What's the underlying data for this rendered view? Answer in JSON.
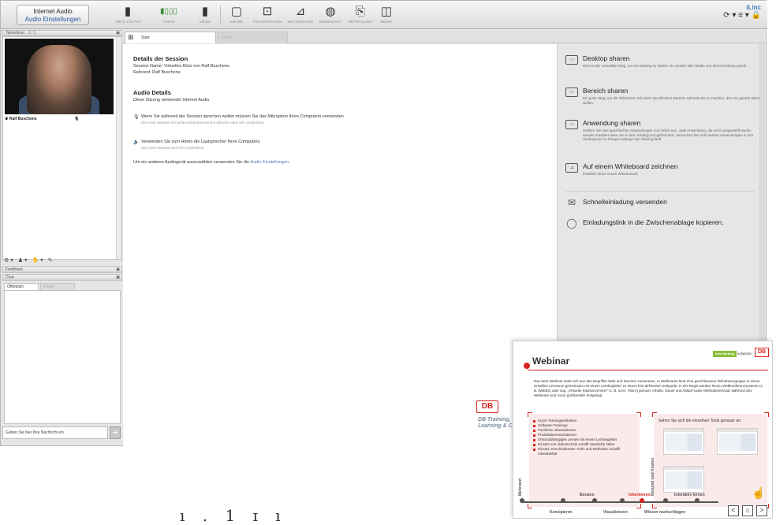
{
  "toolbar": {
    "audio_button": {
      "title": "Internet Audio",
      "subtitle": "Audio Einstellungen"
    },
    "items": [
      {
        "icon": "status-icon",
        "glyph": "▮",
        "label": "MEIN STATUS"
      },
      {
        "icon": "audio-level-icon",
        "glyph": "▮▯▯▯",
        "label": "AUDIO"
      },
      {
        "icon": "video-icon",
        "glyph": "▮",
        "label": "VIDEO"
      },
      {
        "icon": "share-icon",
        "glyph": "▢",
        "label": "SHARE"
      },
      {
        "icon": "presentation-icon",
        "glyph": "⊡",
        "label": "PRÄSENTATION"
      },
      {
        "icon": "whiteboard-icon",
        "glyph": "⊿",
        "label": "WHITEBOARD"
      },
      {
        "icon": "web-content-icon",
        "glyph": "◍",
        "label": "WEBINHALT"
      },
      {
        "icon": "poll-icon",
        "glyph": "⎘",
        "label": "BEFRAGUNG"
      },
      {
        "icon": "media-icon",
        "glyph": "◫",
        "label": "MEDIA"
      }
    ],
    "brand": {
      "name": "iLinc",
      "controls": "⟳ ▾ ≡ ▾ 🔒"
    }
  },
  "participants": {
    "header": "Teilnehmer",
    "count": "1 / 1",
    "participant_name": "Ralf Buschens",
    "controls": "⚙▾ ♟▾ ✋▾ ✎"
  },
  "feedback": {
    "header": "Feedback"
  },
  "chat": {
    "header": "Chat",
    "tabs": [
      "Öffentlich",
      "Privat"
    ],
    "input_placeholder": "Geben Sie hier Ihre Nachricht ein",
    "send_glyph": "➔"
  },
  "tabs": {
    "start": "Start",
    "ghost": "Privat"
  },
  "session": {
    "details_heading": "Details der Session",
    "session_name": "Session Name: Virtuelles Büro von Ralf Buschens",
    "referent": "Referent: Ralf Buschens",
    "audio_heading": "Audio Details",
    "audio_desc": "Diese Sitzung verwendet Internet Audio.",
    "mic_text": "Wenn Sie während der Session sprechen wollen müssen Sie das Mikrophon Ihres Computers verwenden.",
    "mic_hint": "(Ein USB Headset mit geräuschkompensiertem Mikrofon wird sehr empfohlen)",
    "speaker_text": "Verwenden Sie zum Hören die Lautsprecher Ihres Computers.",
    "speaker_hint": "(Ein USB Headset wird sehr empfohlen)",
    "other_text": "Um ein anderes Audiogerät auszuwählen verwenden Sie die",
    "other_link": "Audio Einstellungen."
  },
  "options": [
    {
      "icon": "desktop-share-icon",
      "glyph": "▭",
      "title": "Desktop sharen",
      "desc": "Dies ist der schnellste Weg, um ein Sharing zu starten. Es werden alle Inhalte von Ihrem Desktop geteilt."
    },
    {
      "icon": "area-share-icon",
      "glyph": "▭",
      "title": "Bereich sharen",
      "desc": "Ein guter Weg, um die Teilnehmer auf einen spezifischen Bereich aufmerksam zu machen, den Sie gerade teilen wollen."
    },
    {
      "icon": "app-share-icon",
      "glyph": "▭",
      "title": "Anwendung sharen",
      "desc": "Wählen Sie eine spezifischen Anwendungen zum teilen aus. Jede Anwendung, die nicht ausgewählt wurde, werden maskiert wenn Sie in den Vordergrund geholt wird. Versuchen Sie nicht andere Anwendungen in den Vordergrund zu bringen solange das Sharing läuft."
    },
    {
      "icon": "whiteboard-draw-icon",
      "glyph": "⊿",
      "title": "Auf einem Whiteboard zeichnen",
      "desc": "Erstellen eines neuen Whiteboards"
    },
    {
      "icon": "envelope-icon",
      "glyph": "✉",
      "title": "Schnelleinladung versenden",
      "desc": ""
    },
    {
      "icon": "speech-bubble-icon",
      "glyph": "◯",
      "title": "Einladungslink in die Zwischenablage kopieren.",
      "desc": ""
    }
  ],
  "overlay": {
    "db_logo": "DB",
    "db_text": "DB Training,\nLearning & C",
    "bottom_text": "ı . 1 ɪ ı"
  },
  "slide": {
    "title": "Webinar",
    "logo_new": "new learning",
    "logo_solutions": "solutions",
    "db": "DB",
    "paragraph": "Das Wort Webinar setzt sich aus den Begriffen Web und Seminar zusammen. In Webinaren lernt eine geschlossene Teilnehmergruppe in einem virtuellen Lernraum gemeinsam mit einem Lernbegleiter zu einem fest definierten Zeitpunkt. In der Regel werden hierzu Webkonferenzsysteme (z. B. WebEx) oder sog. „Virtuelle Klassenzimmer“ (z. B. iLinc, Vitero) genutzt. Inhalte, Dauer und Ablauf sowie Methodeneinsatz während des Webinars sind zuvor größtenteils festgelegt.",
    "bullets": [
      "Kurze Trainingseinheiten",
      "Software-Trainings",
      "Fachliche Informationen",
      "Produktdemonstrationen",
      "Ortsunabhängiges Lernen mit einem Lernbegleiter",
      "Einsatz von Videotechnik schafft räumliche Nähe",
      "Einsatz verschiedenster Tools und Methoden schafft Interaktivität"
    ],
    "right_title": "Sehen Sie sich die einzelnen Tools genauer an:",
    "label_mehrwert": "Mehrwert",
    "label_beispiel": "Beispiel und Kosten",
    "timeline_top": [
      "Beraten",
      "Informieren",
      "Interaktiv lernen"
    ],
    "timeline_bottom": [
      "Konzipieren",
      "Visualisieren",
      "Wissen nachschlagen"
    ],
    "nav": [
      "<",
      "⌂",
      ">"
    ]
  },
  "colors": {
    "accent": "#d8241c",
    "link": "#4a7cbf",
    "panel": "#e6e6e6"
  }
}
